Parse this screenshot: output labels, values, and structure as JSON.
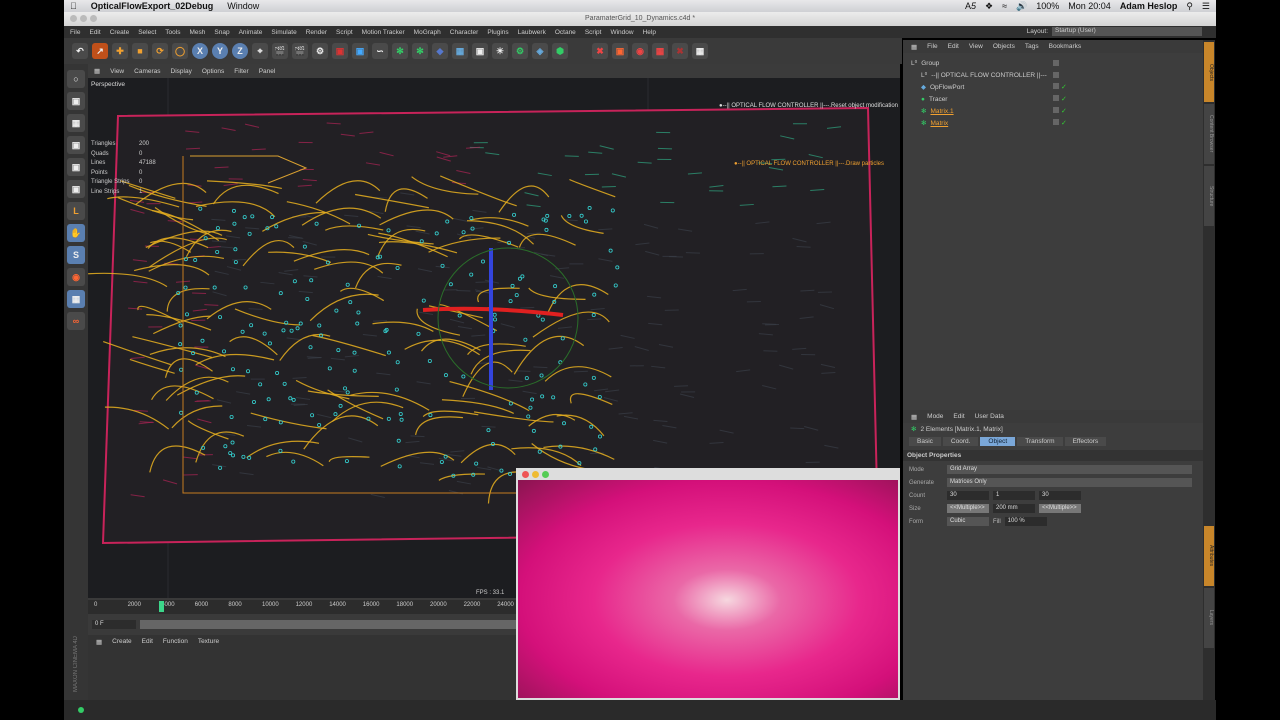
{
  "macbar": {
    "app": "OpticalFlowExport_02Debug",
    "menu": "Window",
    "battery": "100%",
    "time": "Mon 20:04",
    "user": "Adam Heslop",
    "adobe": "5"
  },
  "window": {
    "title": "ParamaterGrid_10_Dynamics.c4d *"
  },
  "menu": [
    "File",
    "Edit",
    "Create",
    "Select",
    "Tools",
    "Mesh",
    "Snap",
    "Animate",
    "Simulate",
    "Render",
    "Script",
    "Motion Tracker",
    "MoGraph",
    "Character",
    "Plugins",
    "Laubwerk",
    "Octane",
    "Script",
    "Window",
    "Help"
  ],
  "layout": {
    "label": "Layout:",
    "value": "Startup (User)"
  },
  "toolbar": {
    "axes": [
      "X",
      "Y",
      "Z"
    ]
  },
  "viewport": {
    "menu": [
      "View",
      "Cameras",
      "Display",
      "Options",
      "Filter",
      "Panel"
    ],
    "camera": "Perspective",
    "stats": [
      [
        "Triangles",
        "200"
      ],
      [
        "Quads",
        "0"
      ],
      [
        "Lines",
        "47188"
      ],
      [
        "Points",
        "0"
      ],
      [
        "Triangle Strips",
        "0"
      ],
      [
        "Line Strips",
        "1"
      ]
    ],
    "label1": "●--|| OPTICAL FLOW CONTROLLER ||---.Reset object modification",
    "label2": "●--|| OPTICAL FLOW CONTROLLER ||---.Draw particles",
    "fps": "FPS : 33.1"
  },
  "timeline": {
    "ticks": [
      "0",
      "2000",
      "4000",
      "6000",
      "8000",
      "10000",
      "12000",
      "14000",
      "16000",
      "18000",
      "20000",
      "22000",
      "24000"
    ],
    "frame": "0 F",
    "playhead": 0.16
  },
  "material": {
    "menu": [
      "Create",
      "Edit",
      "Function",
      "Texture"
    ]
  },
  "objects": {
    "menu": [
      "File",
      "Edit",
      "View",
      "Objects",
      "Tags",
      "Bookmarks"
    ],
    "items": [
      {
        "name": "Group",
        "color": "#cccccc"
      },
      {
        "name": "--|| OPTICAL FLOW CONTROLLER ||---",
        "color": "#cccccc"
      },
      {
        "name": "OpFlowPort",
        "color": "#cccccc"
      },
      {
        "name": "Tracer",
        "color": "#cccccc"
      },
      {
        "name": "Matrix.1",
        "color": "#f0a030"
      },
      {
        "name": "Matrix",
        "color": "#f0a030"
      }
    ]
  },
  "attributes": {
    "menu": [
      "Mode",
      "Edit",
      "User Data"
    ],
    "selection": "2 Elements [Matrix.1, Matrix]",
    "tabs": [
      "Basic",
      "Coord.",
      "Object",
      "Transform",
      "Effectors"
    ],
    "active_tab": "Object",
    "section": "Object Properties",
    "mode_label": "Mode",
    "mode": "Grid Array",
    "generate_label": "Generate",
    "generate": "Matrices Only",
    "count_label": "Count",
    "count": [
      "30",
      "1",
      "30"
    ],
    "size_label": "Size",
    "size": [
      "<<Multiple>>",
      "200 mm",
      "<<Multiple>>"
    ],
    "form_label": "Form",
    "form": "Cubic",
    "fill_label": "Fill",
    "fill": "100 %"
  },
  "sidetabs": [
    "Objects",
    "Content Browser",
    "Structure",
    "Attributes",
    "Layers"
  ],
  "branding": "MAXON CINEMA 4D"
}
